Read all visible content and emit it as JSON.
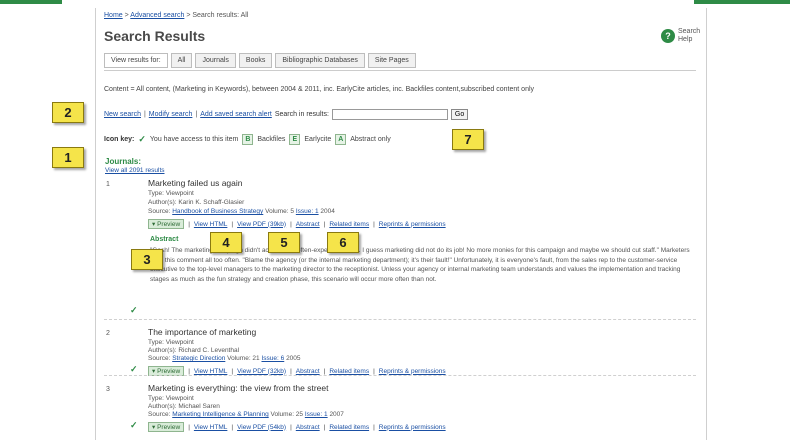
{
  "breadcrumb": {
    "home": "Home",
    "sep1": " > ",
    "advanced": "Advanced search",
    "sep2": " > ",
    "current": "Search results: All"
  },
  "page_title": "Search Results",
  "help": {
    "label": "Search Help"
  },
  "tabs": {
    "label": "View results for:",
    "items": [
      "All",
      "Journals",
      "Books",
      "Bibliographic Databases",
      "Site Pages"
    ]
  },
  "content_description": "Content = All content, (Marketing in Keywords), between 2004 & 2011, inc. EarlyCite articles, inc. Backfiles content,subscribed content only",
  "actions": {
    "new_search": "New search",
    "modify_search": "Modify search",
    "add_alert": "Add saved search alert",
    "sep": "|",
    "search_in_results_label": "Search in results:",
    "search_in_results_value": "",
    "go_label": "Go"
  },
  "icon_key": {
    "label": "Icon key:",
    "access_text": "You have access to this item",
    "b_letter": "B",
    "backfiles": "Backfiles",
    "e_letter": "E",
    "earlycite": "Earlycite",
    "a_letter": "A",
    "abstract_only": "Abstract only"
  },
  "section": {
    "title": "Journals:",
    "view_all": "View all 2091 results"
  },
  "results": [
    {
      "num": "1",
      "title": "Marketing failed us again",
      "type": "Type: Viewpoint",
      "authors": "Author(s): Karin K. Schaff-Glasier",
      "source_label": "Source:",
      "source": "Handbook of Business Strategy",
      "volume": "Volume: 5",
      "issue": "Issue: 1",
      "year": "2004",
      "abstract_title": "Abstract",
      "abstract": "\"Gosh! The marketing campaign didn't achieve the often-expected return. I guess marketing did not do its job! No more monies for this campaign and maybe we should cut staff.\" Marketers hear this comment all too often. \"Blame the agency (or the internal marketing department); it's their fault!\" Unfortunately, it is everyone's fault, from the sales rep to the customer-service executive to the top-level managers to the marketing director to the receptionist. Unless your agency or internal marketing team understands and values the implementation and tracking stages as much as the fun strategy and creation phase, this scenario will occur more often than not."
    },
    {
      "num": "2",
      "title": "The importance of marketing",
      "type": "Type: Viewpoint",
      "authors": "Author(s): Richard C. Leventhal",
      "source_label": "Source:",
      "source": "Strategic Direction",
      "volume": "Volume: 21",
      "issue": "Issue: 6",
      "year": "2005"
    },
    {
      "num": "3",
      "title": "Marketing is everything: the view from the street",
      "type": "Type: Viewpoint",
      "authors": "Author(s): Michael Saren",
      "source_label": "Source:",
      "source": "Marketing Intelligence & Planning",
      "volume": "Volume: 25",
      "issue": "Issue: 1",
      "year": "2007"
    }
  ],
  "result_links": [
    {
      "preview": "▾ Preview",
      "html": "View HTML",
      "pdf": "View PDF (39kb)",
      "abstract": "Abstract",
      "related": "Related items",
      "reprints": "Reprints & permissions"
    },
    {
      "preview": "▾ Preview",
      "html": "View HTML",
      "pdf": "View PDF (32kb)",
      "abstract": "Abstract",
      "related": "Related items",
      "reprints": "Reprints & permissions"
    },
    {
      "preview": "▾ Preview",
      "html": "View HTML",
      "pdf": "View PDF (54kb)",
      "abstract": "Abstract",
      "related": "Related items",
      "reprints": "Reprints & permissions"
    }
  ],
  "link_sep": "|",
  "check_mark": "✓",
  "callouts": [
    "1",
    "2",
    "3",
    "4",
    "5",
    "6",
    "7"
  ],
  "colors": {
    "accent": "#2e8b46",
    "link": "#1a4fa3",
    "callout": "#f5e44a"
  }
}
